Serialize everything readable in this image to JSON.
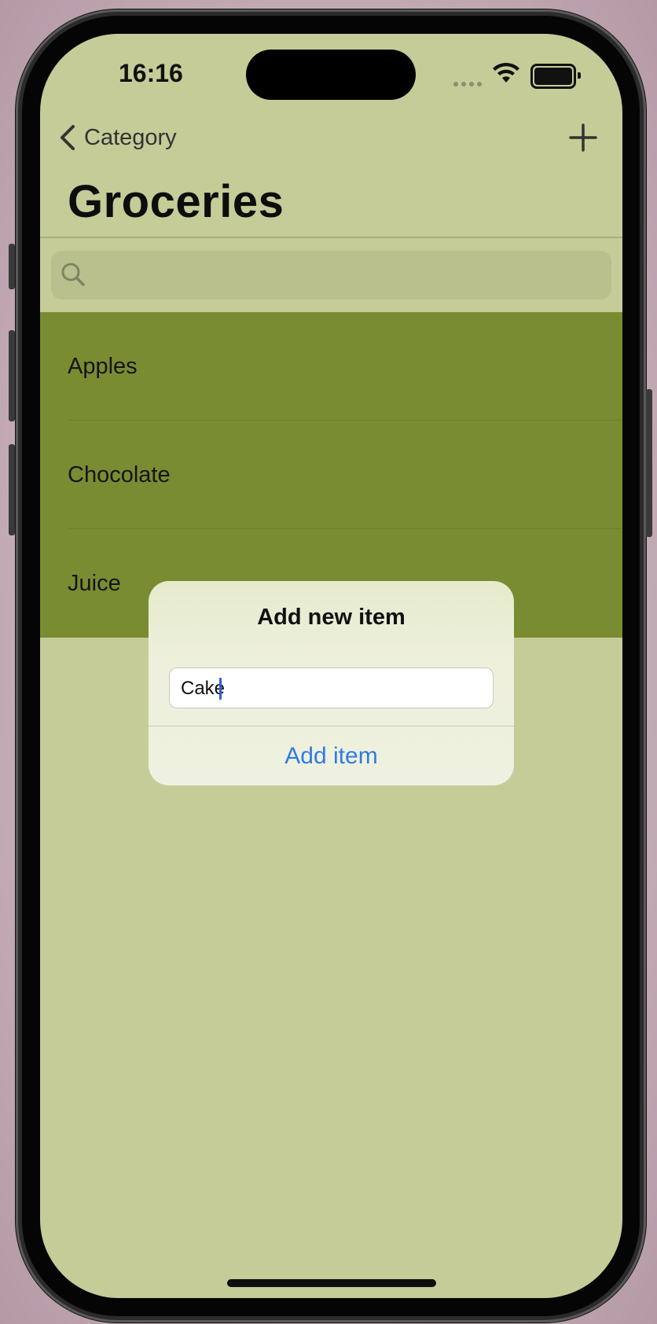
{
  "status_bar": {
    "time": "16:16",
    "icons": [
      "cellular-signal-icon",
      "wifi-icon",
      "battery-icon"
    ]
  },
  "nav": {
    "back_label": "Category",
    "title": "Groceries",
    "add_icon": "plus-icon"
  },
  "search": {
    "placeholder": "",
    "icon": "search-icon"
  },
  "list": {
    "items": [
      {
        "label": "Apples"
      },
      {
        "label": "Chocolate"
      },
      {
        "label": "Juice"
      }
    ]
  },
  "alert": {
    "title": "Add new item",
    "input_value": "Cake",
    "button_label": "Add item"
  },
  "colors": {
    "background": "#c5cc97",
    "list_row": "#798c32",
    "alert_button": "#2f7be3"
  }
}
